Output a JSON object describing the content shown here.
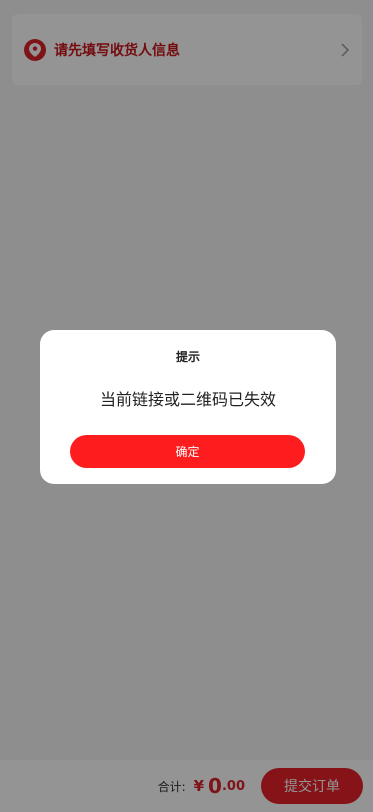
{
  "address": {
    "prompt": "请先填写收货人信息",
    "icon": "location-pin-icon",
    "arrow_icon": "chevron-right-icon"
  },
  "footer": {
    "total_label": "合计:",
    "currency": "¥",
    "amount_int": "0",
    "amount_dec": ".00",
    "submit_label": "提交订单"
  },
  "dialog": {
    "title": "提示",
    "message": "当前链接或二维码已失效",
    "confirm_label": "确定"
  },
  "colors": {
    "accent": "#d9242a",
    "confirm": "#fd1d1f",
    "overlay": "rgba(0,0,0,0.42)"
  }
}
